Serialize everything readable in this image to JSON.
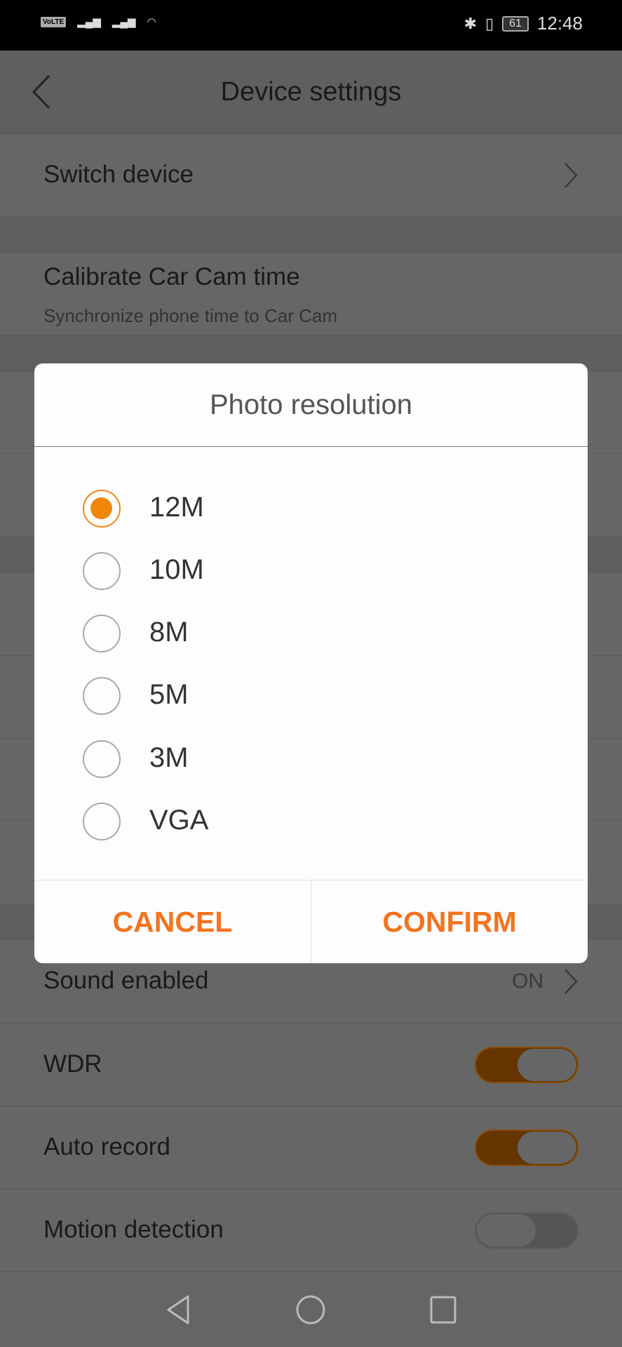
{
  "status_bar": {
    "volte": "VoLTE",
    "sim": "1",
    "battery": "61",
    "time": "12:48"
  },
  "header": {
    "title": "Device settings"
  },
  "settings": {
    "switch_device": "Switch device",
    "calibrate": {
      "label": "Calibrate Car Cam time",
      "sub": "Synchronize phone time to Car Cam"
    },
    "sound": {
      "label": "Sound enabled",
      "value": "ON"
    },
    "wdr": {
      "label": "WDR",
      "on": true
    },
    "auto_record": {
      "label": "Auto record",
      "on": true
    },
    "motion": {
      "label": "Motion detection",
      "on": false
    }
  },
  "dialog": {
    "title": "Photo resolution",
    "options": [
      "12M",
      "10M",
      "8M",
      "5M",
      "3M",
      "VGA"
    ],
    "selected": "12M",
    "cancel": "CANCEL",
    "confirm": "CONFIRM"
  },
  "colors": {
    "accent": "#f4731f",
    "radio_selected": "#f0860c"
  }
}
